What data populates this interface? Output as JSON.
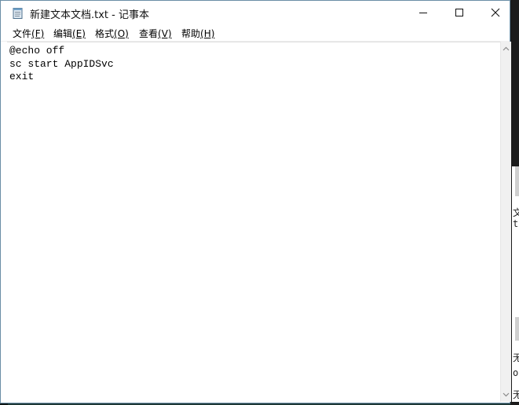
{
  "window": {
    "title": "新建文本文档.txt - 记事本",
    "icon": "notepad-icon",
    "controls": {
      "minimize_icon": "minimize-icon",
      "maximize_icon": "maximize-icon",
      "close_icon": "close-icon"
    }
  },
  "menu": {
    "items": [
      {
        "label": "文件",
        "accel": "(F)"
      },
      {
        "label": "编辑",
        "accel": "(E)"
      },
      {
        "label": "格式",
        "accel": "(O)"
      },
      {
        "label": "查看",
        "accel": "(V)"
      },
      {
        "label": "帮助",
        "accel": "(H)"
      }
    ]
  },
  "editor": {
    "lines": [
      "@echo off",
      "sc start AppIDSvc",
      "exit"
    ]
  },
  "background": {
    "glyphs": [
      "文",
      "t",
      "无",
      "o",
      "无"
    ]
  },
  "colors": {
    "window_border": "#6b8ea6",
    "scrollbar": "#f0f0f0"
  }
}
